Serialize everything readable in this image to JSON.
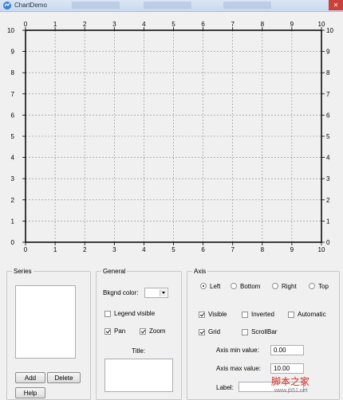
{
  "window": {
    "title": "ChartDemo",
    "close_glyph": "✕"
  },
  "chart_data": {
    "type": "line",
    "x": [],
    "series": [],
    "xlim": [
      0,
      10
    ],
    "ylim": [
      0,
      10
    ],
    "x_ticks": [
      "0",
      "1",
      "2",
      "3",
      "4",
      "5",
      "6",
      "7",
      "8",
      "9",
      "10"
    ],
    "y_ticks": [
      "0",
      "1",
      "2",
      "3",
      "4",
      "5",
      "6",
      "7",
      "8",
      "9",
      "10"
    ],
    "top_ticks": [
      "0",
      "1",
      "2",
      "3",
      "4",
      "5",
      "6",
      "7",
      "8",
      "9",
      "10"
    ],
    "right_ticks": [
      "0",
      "1",
      "2",
      "3",
      "4",
      "5",
      "6",
      "7",
      "8",
      "9",
      "10"
    ],
    "grid": true,
    "title": "",
    "xlabel": "",
    "ylabel": ""
  },
  "series_panel": {
    "legend": "Series",
    "add_label": "Add",
    "delete_label": "Delete",
    "help_label": "Help"
  },
  "general_panel": {
    "legend": "General",
    "bkgnd_label": "Bkgnd color:",
    "legend_visible_label": "Legend visible",
    "legend_visible_checked": false,
    "pan_label": "Pan",
    "pan_checked": true,
    "zoom_label": "Zoom",
    "zoom_checked": true,
    "title_label": "Title:"
  },
  "axis_panel": {
    "legend": "Axis",
    "radio_left": "Left",
    "radio_bottom": "Bottom",
    "radio_right": "Right",
    "radio_top": "Top",
    "selected": "Left",
    "visible_label": "Visible",
    "visible_checked": true,
    "inverted_label": "Inverted",
    "inverted_checked": false,
    "automatic_label": "Automatic",
    "automatic_checked": false,
    "grid_label": "Grid",
    "grid_checked": true,
    "scrollbar_label": "ScrollBar",
    "scrollbar_checked": false,
    "min_label": "Axis min value:",
    "min_value": "0.00",
    "max_label": "Axis max value:",
    "max_value": "10.00",
    "label_label": "Label:",
    "label_value": ""
  },
  "watermark": {
    "text_cn": "脚本之家",
    "url": "www.jb51.net"
  },
  "colors": {
    "grid": "#8a8a8a",
    "plot_border": "#000000",
    "title_bar": "#c9d9ee"
  }
}
